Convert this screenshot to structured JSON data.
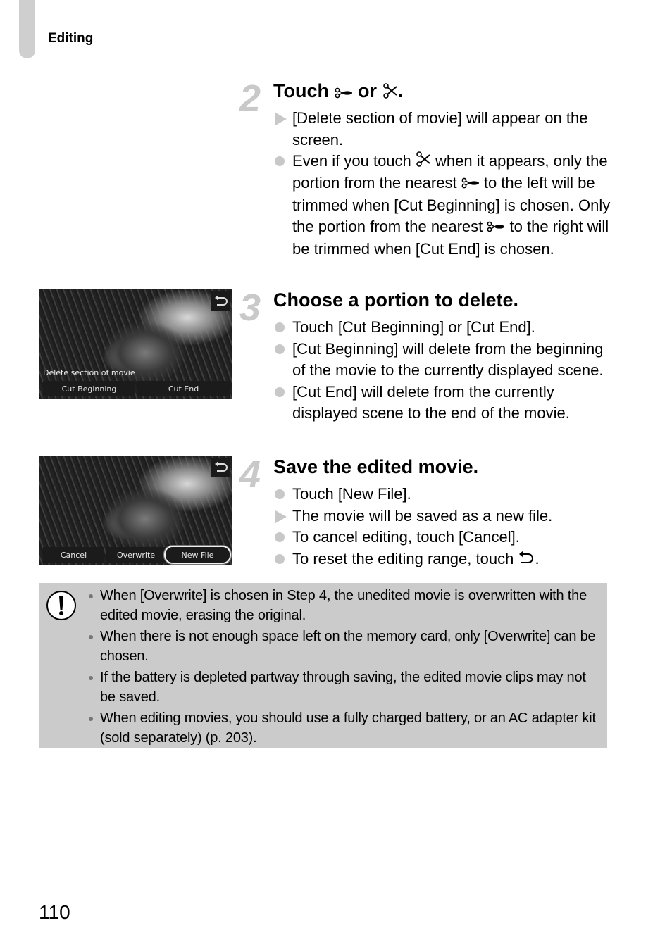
{
  "header": {
    "section": "Editing"
  },
  "steps": [
    {
      "number": "2",
      "title_parts": [
        "Touch",
        "or",
        "."
      ],
      "title_icons": [
        "scissors-marker-icon",
        "scissors-icon"
      ],
      "items": [
        {
          "marker": "arrow",
          "text": "[Delete section of movie] will appear on the screen."
        },
        {
          "marker": "dot",
          "parts": [
            "Even if you touch",
            "when it appears, only the portion from the nearest",
            "to the left will be trimmed when [Cut Beginning] is chosen. Only the portion from the nearest",
            "to the right will be trimmed when [Cut End] is chosen."
          ],
          "icons": [
            "scissors-icon",
            "scissors-marker-icon",
            "scissors-marker-icon"
          ]
        }
      ]
    },
    {
      "number": "3",
      "title": "Choose a portion to delete.",
      "items": [
        {
          "marker": "dot",
          "text": "Touch [Cut Beginning] or [Cut End]."
        },
        {
          "marker": "dot",
          "text": "[Cut Beginning] will delete from the beginning of the movie to the currently displayed scene."
        },
        {
          "marker": "dot",
          "text": "[Cut End] will delete from the currently displayed scene to the end of the movie."
        }
      ],
      "screen": {
        "caption": "Delete section of movie",
        "buttons": [
          "Cut Beginning",
          "Cut End"
        ]
      }
    },
    {
      "number": "4",
      "title": "Save the edited movie.",
      "items": [
        {
          "marker": "dot",
          "text": "Touch [New File]."
        },
        {
          "marker": "arrow",
          "text": "The movie will be saved as a new file."
        },
        {
          "marker": "dot",
          "text": "To cancel editing, touch [Cancel]."
        },
        {
          "marker": "dot",
          "text": "To reset the editing range, touch",
          "suffix": ".",
          "icon": "return-icon"
        }
      ],
      "screen": {
        "buttons": [
          "Cancel",
          "Overwrite",
          "New File"
        ],
        "highlighted": "New File"
      }
    }
  ],
  "caution": {
    "icon": "caution-icon",
    "items": [
      "When [Overwrite] is chosen in Step 4, the unedited movie is overwritten with the edited movie, erasing the original.",
      "When there is not enough space left on the memory card, only [Overwrite] can be chosen.",
      "If the battery is depleted partway through saving, the edited movie clips may not be saved.",
      "When editing movies, you should use a fully charged battery, or an AC adapter kit (sold separately) (p. 203)."
    ]
  },
  "page_number": "110"
}
